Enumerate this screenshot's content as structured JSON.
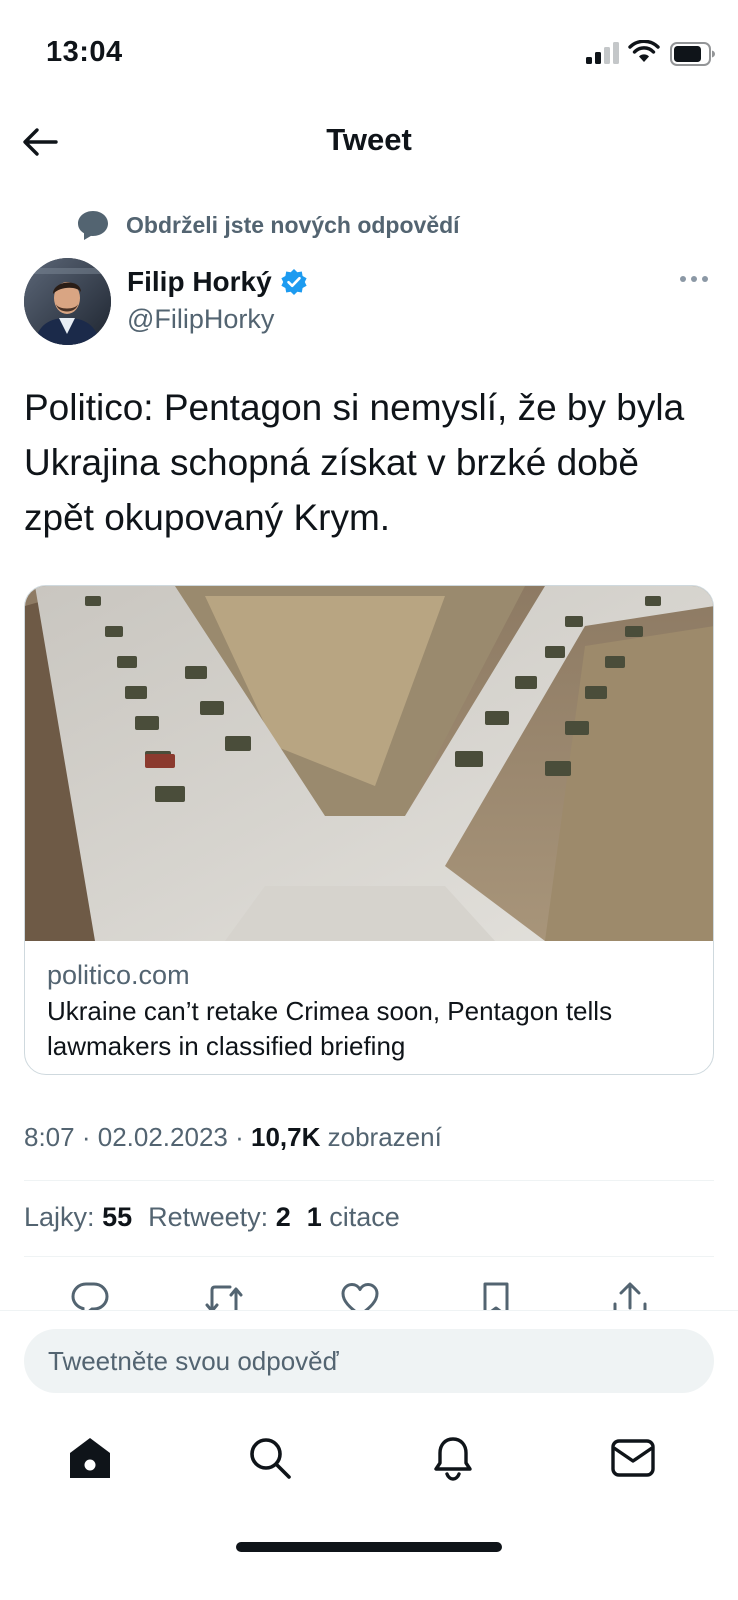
{
  "status_bar": {
    "time": "13:04",
    "icons": [
      "signal-icon",
      "wifi-icon",
      "battery-icon"
    ]
  },
  "header": {
    "title": "Tweet",
    "back_icon": "back-arrow-icon"
  },
  "notice": {
    "text": "Obdrželi jste nových odpovědí",
    "icon": "speech-bubble-icon"
  },
  "tweet": {
    "author_name": "Filip Horký",
    "author_handle": "@FilipHorky",
    "verified": true,
    "text": "Politico: Pentagon si nemyslí, že by byla Ukrajina schopná získat v brzké době zpět okupovaný Krym.",
    "card": {
      "domain": "politico.com",
      "title": "Ukraine can’t retake Crimea soon, Pentagon tells lawmakers in classified briefing"
    },
    "time": "8:07",
    "date": "02.02.2023",
    "views_count": "10,7K",
    "views_label": "zobrazení",
    "likes_label": "Lajky:",
    "likes_count": "55",
    "retweets_label": "Retweety:",
    "retweets_count": "2",
    "quotes_count": "1",
    "quotes_label": "citace"
  },
  "actions": [
    "reply-icon",
    "retweet-icon",
    "like-icon",
    "bookmark-icon",
    "share-icon"
  ],
  "reply": {
    "placeholder": "Tweetněte svou odpověď"
  },
  "tab_bar": [
    "home-icon",
    "search-icon",
    "notifications-icon",
    "messages-icon"
  ],
  "colors": {
    "text": "#0f1419",
    "secondary": "#536471",
    "verified": "#1d9bf0",
    "input_bg": "#eff3f4",
    "border": "#cfd9de"
  }
}
